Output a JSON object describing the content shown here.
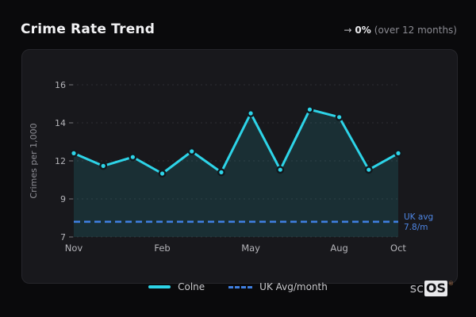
{
  "header": {
    "title": "Crime Rate Trend",
    "trend_arrow": "→",
    "trend_value": "0%",
    "trend_period": "(over 12 months)"
  },
  "chart_data": {
    "type": "line",
    "ylabel": "Crimes per 1,000",
    "n_points": 12,
    "x_ticks": [
      {
        "index": 0,
        "label": "Nov"
      },
      {
        "index": 3,
        "label": "Feb"
      },
      {
        "index": 6,
        "label": "May"
      },
      {
        "index": 9,
        "label": "Aug"
      },
      {
        "index": 11,
        "label": "Oct"
      }
    ],
    "y_ticks": [
      7,
      9,
      12,
      14,
      16
    ],
    "grid": "dashed-horizontal",
    "legend_position": "bottom",
    "series": [
      {
        "name": "Colne",
        "type": "line-area-markers",
        "color": "#2dd4e8",
        "values": [
          12.4,
          11.6,
          12.2,
          11.0,
          12.5,
          11.1,
          14.5,
          11.3,
          14.7,
          14.3,
          11.3,
          12.4
        ]
      },
      {
        "name": "UK Avg/month",
        "type": "dashed-reference-line",
        "color": "#3f7fe0",
        "value": 7.8
      }
    ],
    "reference_annotation": {
      "line1": "UK avg",
      "line2": "7.8/m"
    }
  },
  "legend": {
    "items": [
      {
        "label": "Colne",
        "swatch": "solid-cyan"
      },
      {
        "label": "UK Avg/month",
        "swatch": "dashed-blue"
      }
    ]
  },
  "logo": {
    "prefix": "sc",
    "suffix": "OS",
    "registered": "®"
  },
  "colors": {
    "page_bg": "#0a0a0c",
    "card_bg": "#18181c",
    "series_line": "#2dd4e8",
    "reference_line": "#3f7fe0",
    "annotation_text": "#4e86e4",
    "axis_text": "#b4b4b9",
    "muted_text": "#8b8b92"
  }
}
